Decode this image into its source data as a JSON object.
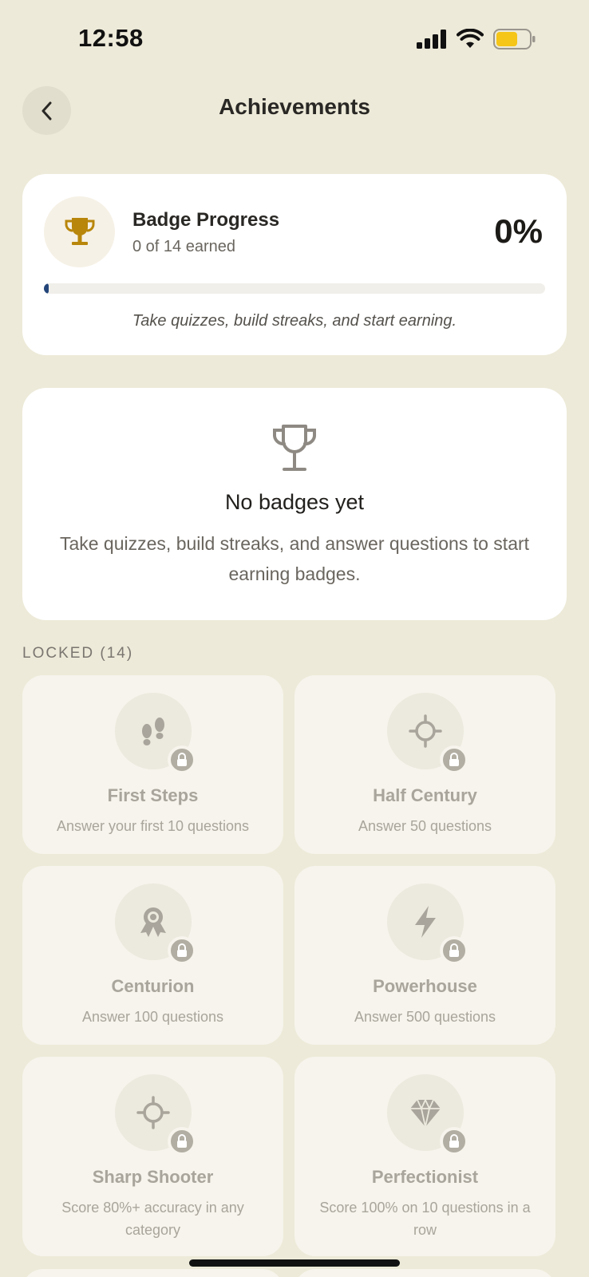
{
  "status_bar": {
    "time": "12:58",
    "battery_color": "#F5C518"
  },
  "header": {
    "title": "Achievements"
  },
  "progress": {
    "title": "Badge Progress",
    "subtitle": "0 of 14 earned",
    "percent_label": "0%",
    "percent_value": 0,
    "hint": "Take quizzes, build streaks, and start earning.",
    "bar_color": "#23457A",
    "trophy_color": "#B8860B"
  },
  "empty_state": {
    "title": "No badges yet",
    "description": "Take quizzes, build streaks, and answer questions to start earning badges."
  },
  "locked_section": {
    "label": "LOCKED (14)"
  },
  "badges": [
    {
      "name": "First Steps",
      "description": "Answer your first 10 questions",
      "icon": "footsteps-icon"
    },
    {
      "name": "Half Century",
      "description": "Answer 50 questions",
      "icon": "crosshair-icon"
    },
    {
      "name": "Centurion",
      "description": "Answer 100 questions",
      "icon": "award-ribbon-icon"
    },
    {
      "name": "Powerhouse",
      "description": "Answer 500 questions",
      "icon": "lightning-icon"
    },
    {
      "name": "Sharp Shooter",
      "description": "Score 80%+ accuracy in any category",
      "icon": "crosshair-icon"
    },
    {
      "name": "Perfectionist",
      "description": "Score 100% on 10 questions in a row",
      "icon": "diamond-icon"
    }
  ]
}
